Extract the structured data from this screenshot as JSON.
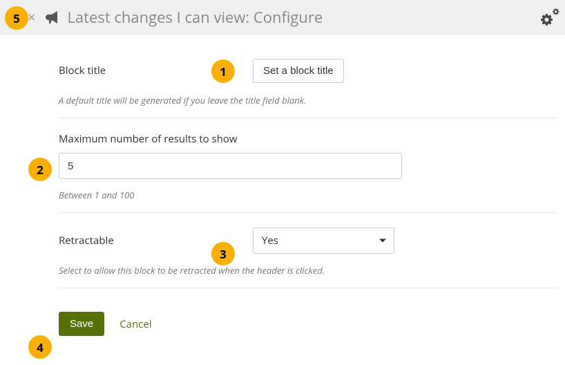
{
  "header": {
    "close_glyph": "×",
    "title": "Latest changes I can view: Configure"
  },
  "block_title": {
    "label": "Block title",
    "button": "Set a block title",
    "help": "A default title will be generated if you leave the title field blank."
  },
  "max_results": {
    "label": "Maximum number of results to show",
    "value": "5",
    "help": "Between 1 and 100"
  },
  "retractable": {
    "label": "Retractable",
    "selected": "Yes",
    "help": "Select to allow this block to be retracted when the header is clicked."
  },
  "actions": {
    "save": "Save",
    "cancel": "Cancel"
  },
  "badges": {
    "b1": "1",
    "b2": "2",
    "b3": "3",
    "b4": "4",
    "b5": "5"
  }
}
